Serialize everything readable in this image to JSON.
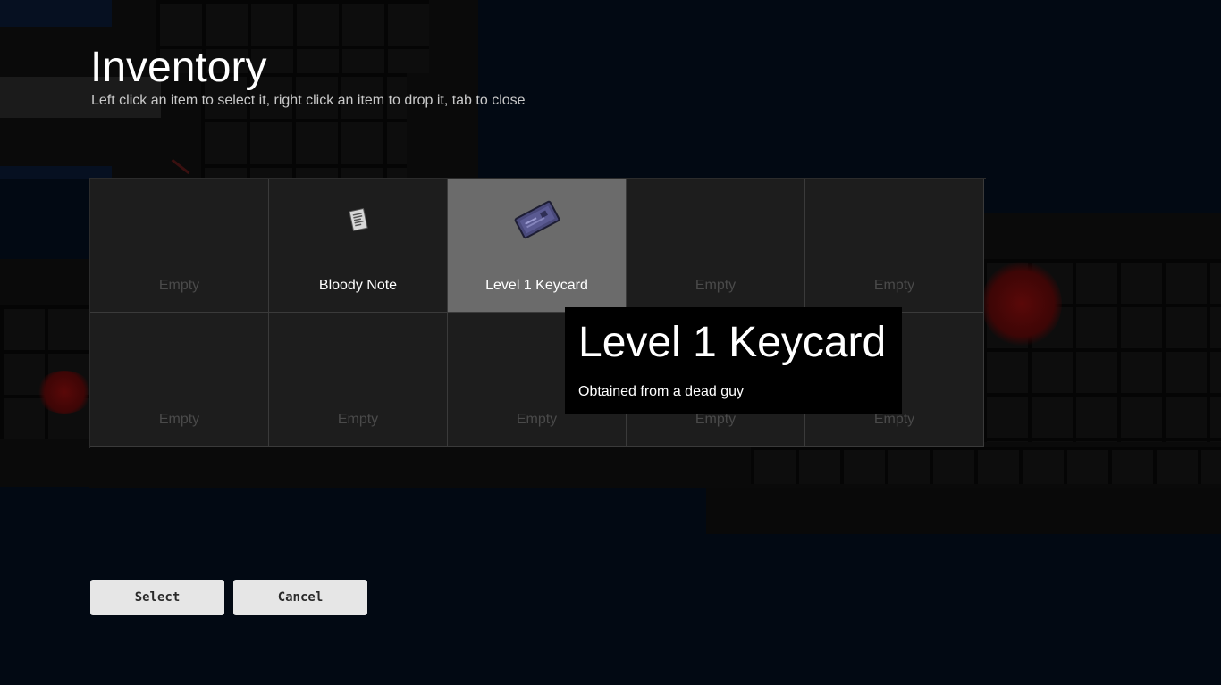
{
  "inventory": {
    "title": "Inventory",
    "instructions": "Left click an item to select it, right click an item to drop it, tab to close",
    "slots": [
      {
        "label": "Empty",
        "filled": false,
        "selected": false,
        "icon": ""
      },
      {
        "label": "Bloody Note",
        "filled": true,
        "selected": false,
        "icon": "note-icon"
      },
      {
        "label": "Level 1 Keycard",
        "filled": true,
        "selected": true,
        "icon": "keycard-icon"
      },
      {
        "label": "Empty",
        "filled": false,
        "selected": false,
        "icon": ""
      },
      {
        "label": "Empty",
        "filled": false,
        "selected": false,
        "icon": ""
      },
      {
        "label": "Empty",
        "filled": false,
        "selected": false,
        "icon": ""
      },
      {
        "label": "Empty",
        "filled": false,
        "selected": false,
        "icon": ""
      },
      {
        "label": "Empty",
        "filled": false,
        "selected": false,
        "icon": ""
      },
      {
        "label": "Empty",
        "filled": false,
        "selected": false,
        "icon": ""
      },
      {
        "label": "Empty",
        "filled": false,
        "selected": false,
        "icon": ""
      }
    ]
  },
  "tooltip": {
    "title": "Level 1 Keycard",
    "description": "Obtained from a dead guy"
  },
  "buttons": {
    "select_label": "Select",
    "cancel_label": "Cancel"
  },
  "colors": {
    "backdrop": "#020913",
    "slot": "#1d1d1d",
    "slot_selected": "#6b6b6b",
    "button": "#e6e6e6"
  }
}
